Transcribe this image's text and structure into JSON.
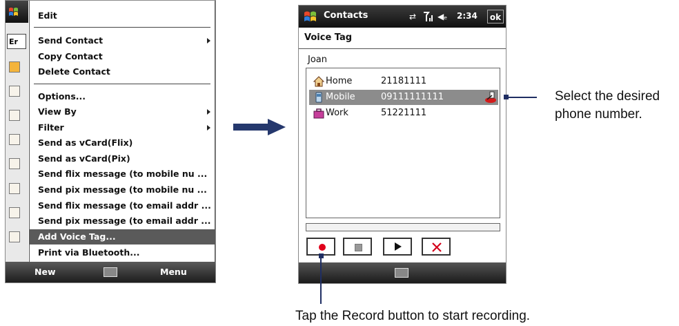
{
  "left_phone": {
    "menu_items": [
      {
        "label": "Edit",
        "submenu": false
      },
      {
        "label": "Send Contact",
        "submenu": true
      },
      {
        "label": "Copy Contact",
        "submenu": false
      },
      {
        "label": "Delete Contact",
        "submenu": false
      },
      {
        "label": "Options...",
        "submenu": false
      },
      {
        "label": "View By",
        "submenu": true
      },
      {
        "label": "Filter",
        "submenu": true
      },
      {
        "label": "Send as vCard(Flix)",
        "submenu": false
      },
      {
        "label": "Send as vCard(Pix)",
        "submenu": false
      },
      {
        "label": "Send flix message (to mobile nu  ...",
        "submenu": false
      },
      {
        "label": "Send pix message (to mobile nu  ...",
        "submenu": false
      },
      {
        "label": "Send flix message (to email addr ...",
        "submenu": false
      },
      {
        "label": "Send pix message (to email addr ...",
        "submenu": false
      },
      {
        "label": "Add Voice Tag...",
        "submenu": false,
        "selected": true
      },
      {
        "label": "Print via Bluetooth...",
        "submenu": false
      }
    ],
    "partial_left_text": "Er",
    "softkeys": {
      "left": "New",
      "right": "Menu"
    }
  },
  "right_phone": {
    "title": "Contacts",
    "time": "2:34",
    "ok_label": "ok",
    "page_title": "Voice Tag",
    "contact_name": "Joan",
    "numbers": [
      {
        "label": "Home",
        "number": "21181111",
        "icon": "home-icon",
        "selected": false
      },
      {
        "label": "Mobile",
        "number": "09111111111",
        "icon": "mobile-icon",
        "selected": true,
        "has_voice_tag": true
      },
      {
        "label": "Work",
        "number": "51221111",
        "icon": "work-icon",
        "selected": false
      }
    ],
    "controls": [
      "record-icon",
      "stop-icon",
      "play-icon",
      "delete-icon"
    ],
    "colors": {
      "record": "#e0001b",
      "delete": "#d4001a",
      "selection": "#8c8c8c"
    }
  },
  "callouts": {
    "select_number": [
      "Select the desired",
      "phone number."
    ],
    "record": "Tap the Record button to start recording."
  }
}
